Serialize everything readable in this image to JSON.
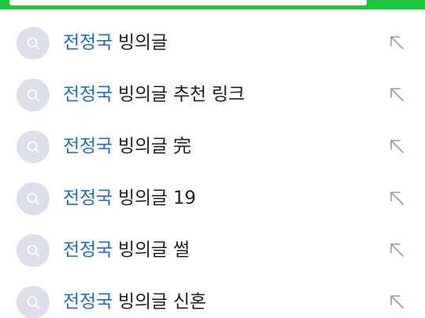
{
  "query": "전정국",
  "suggestions": [
    {
      "highlight": "전정국",
      "rest": " 빙의글"
    },
    {
      "highlight": "전정국",
      "rest": " 빙의글 추천 링크"
    },
    {
      "highlight": "전정국",
      "rest": " 빙의글 完"
    },
    {
      "highlight": "전정국",
      "rest": " 빙의글 19"
    },
    {
      "highlight": "전정국",
      "rest": " 빙의글 썰"
    },
    {
      "highlight": "전정국",
      "rest": " 빙의글 신혼"
    }
  ],
  "colors": {
    "header": "#1fc33c",
    "highlight": "#1e6fb7",
    "text": "#1f1f1f",
    "icon_circle": "#dde0ea",
    "arrow": "#9a9a9a"
  },
  "icons": {
    "search": "search-icon",
    "fill_query": "arrow-up-left-icon"
  }
}
